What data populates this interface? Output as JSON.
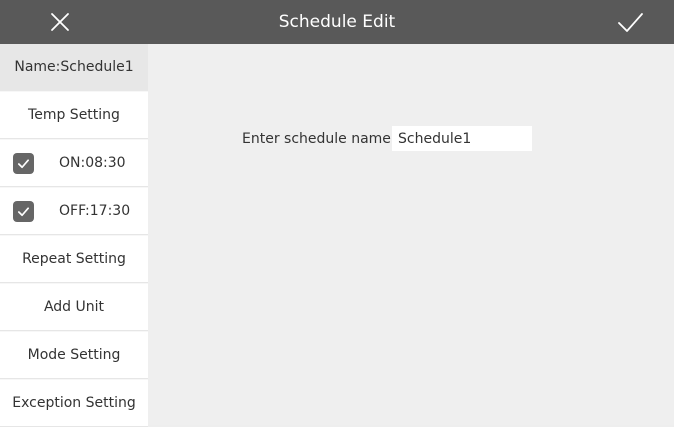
{
  "header": {
    "title": "Schedule Edit",
    "close_icon": "close-icon",
    "confirm_icon": "checkmark-icon"
  },
  "sidebar": {
    "items": [
      {
        "label": "Name:Schedule1",
        "active": true
      },
      {
        "label": "Temp Setting"
      },
      {
        "label": "ON:08:30",
        "checked": true,
        "icon": "checkbox-checked-icon"
      },
      {
        "label": "OFF:17:30",
        "checked": true,
        "icon": "checkbox-checked-icon"
      },
      {
        "label": "Repeat Setting"
      },
      {
        "label": "Add Unit"
      },
      {
        "label": "Mode Setting"
      },
      {
        "label": "Exception Setting"
      }
    ]
  },
  "main": {
    "name_label": "Enter schedule name:",
    "name_value": "Schedule1"
  },
  "colors": {
    "header_bg": "#595959",
    "page_bg": "#efefef",
    "active_item_bg": "#e7e7e7",
    "checkbox_bg": "#666666"
  }
}
